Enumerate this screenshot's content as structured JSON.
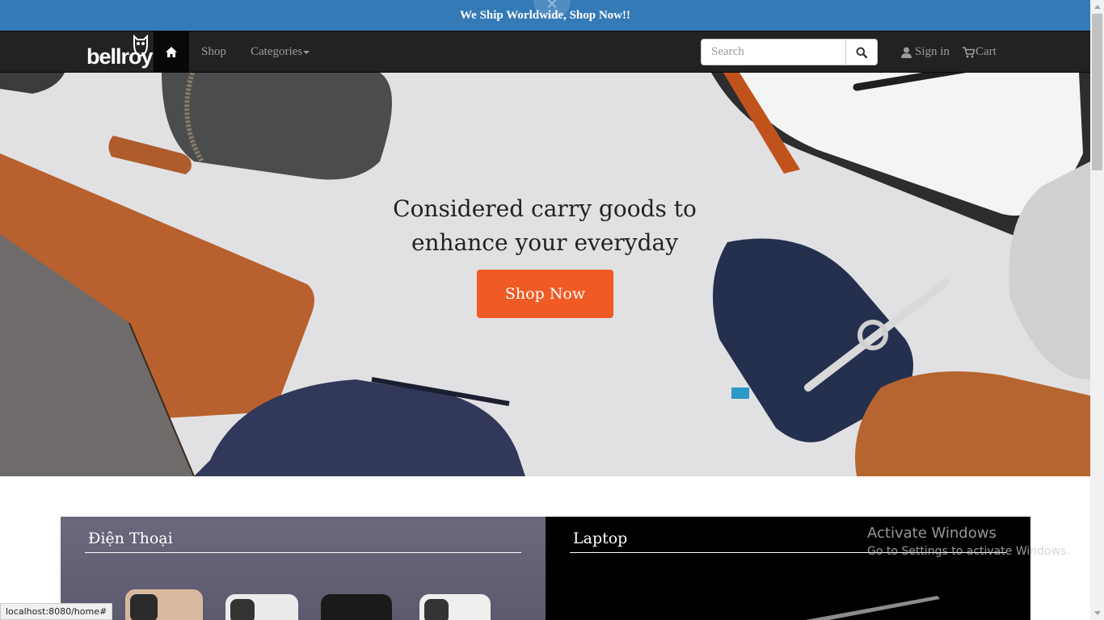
{
  "promo": {
    "text": "We Ship Worldwide, Shop Now!!",
    "close_icon": "close-icon"
  },
  "navbar": {
    "logo_text": "bellroy",
    "home_icon": "home-icon",
    "shop_label": "Shop",
    "categories_label": "Categories",
    "search_placeholder": "Search",
    "signin_label": "Sign in",
    "cart_label": "Cart"
  },
  "hero": {
    "title_line1": "Considered carry goods to",
    "title_line2": "enhance your everyday",
    "button_label": "Shop Now"
  },
  "categories": [
    {
      "title": "Điện Thoại"
    },
    {
      "title": "Laptop"
    }
  ],
  "watermark": {
    "title": "Activate Windows",
    "subtitle": "Go to Settings to activate Windows."
  },
  "status_url": "localhost:8080/home#",
  "colors": {
    "promo": "#337ab7",
    "navbar": "#222222",
    "cta": "#f05a24"
  }
}
